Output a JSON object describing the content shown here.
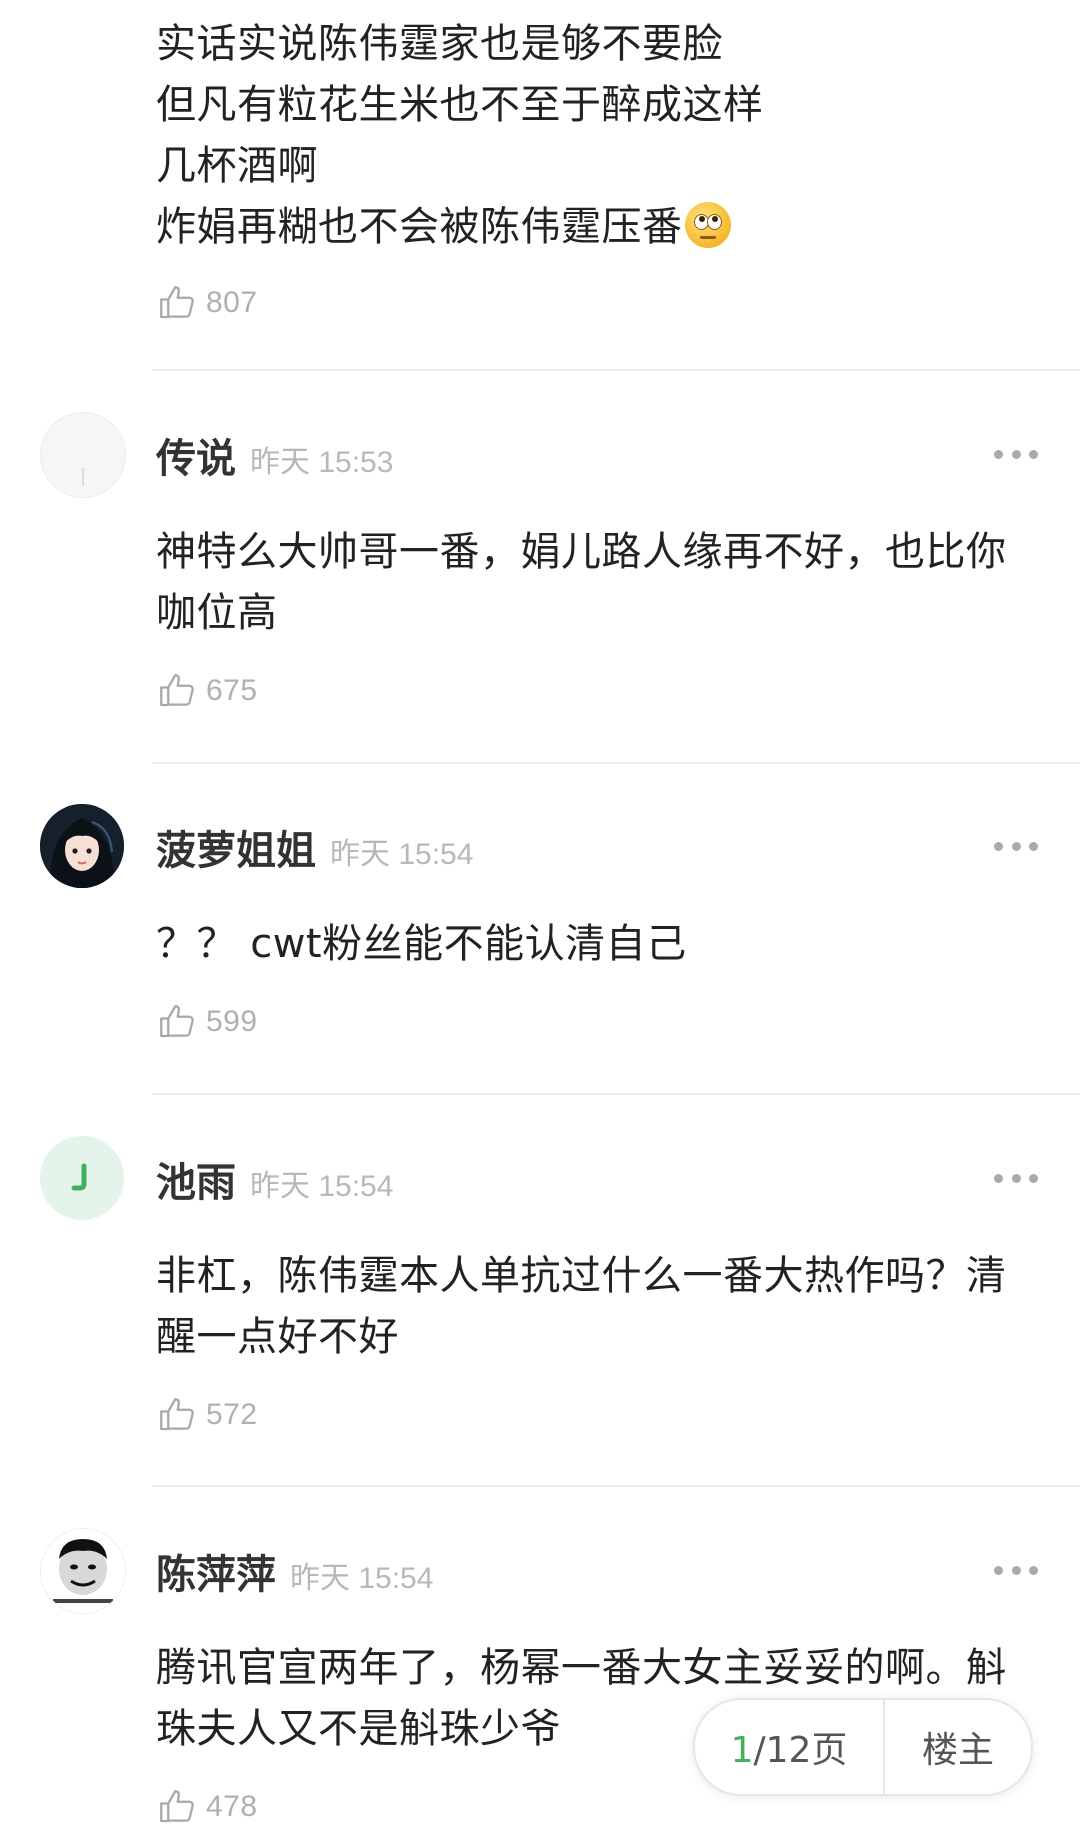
{
  "top_comment": {
    "lines": [
      "实话实说陈伟霆家也是够不要脸",
      "但凡有粒花生米也不至于醉成这样",
      "几杯酒啊",
      "炸娟再糊也不会被陈伟霆压番"
    ],
    "emoji": "eye-roll-emoji",
    "likes": "807"
  },
  "comments": [
    {
      "username": "传说",
      "time": "昨天 15:53",
      "lines": [
        "神特么大帅哥一番，娟儿路人缘再不好，也比你",
        "咖位高"
      ],
      "likes": "675",
      "avatar": "blank-avatar"
    },
    {
      "username": "菠萝姐姐",
      "time": "昨天 15:54",
      "lines": [
        "？？ cwt粉丝能不能认清自己"
      ],
      "likes": "599",
      "avatar": "anime-girl-avatar"
    },
    {
      "username": "池雨",
      "time": "昨天 15:54",
      "lines": [
        "非杠，陈伟霆本人单抗过什么一番大热作吗？清",
        "醒一点好不好"
      ],
      "likes": "572",
      "avatar": "green-default-avatar"
    },
    {
      "username": "陈萍萍",
      "time": "昨天 15:54",
      "lines": [
        "腾讯官宣两年了，杨幂一番大女主妥妥的啊。斛",
        "珠夫人又不是斛珠少爷"
      ],
      "likes": "478",
      "avatar": "meme-face-avatar"
    }
  ],
  "pager": {
    "current": "1",
    "total_suffix": "/12页",
    "op_label": "楼主"
  },
  "colors": {
    "accent": "#3fb15d",
    "muted": "#b0b0b0",
    "text": "#222222",
    "divider": "#ececec"
  }
}
